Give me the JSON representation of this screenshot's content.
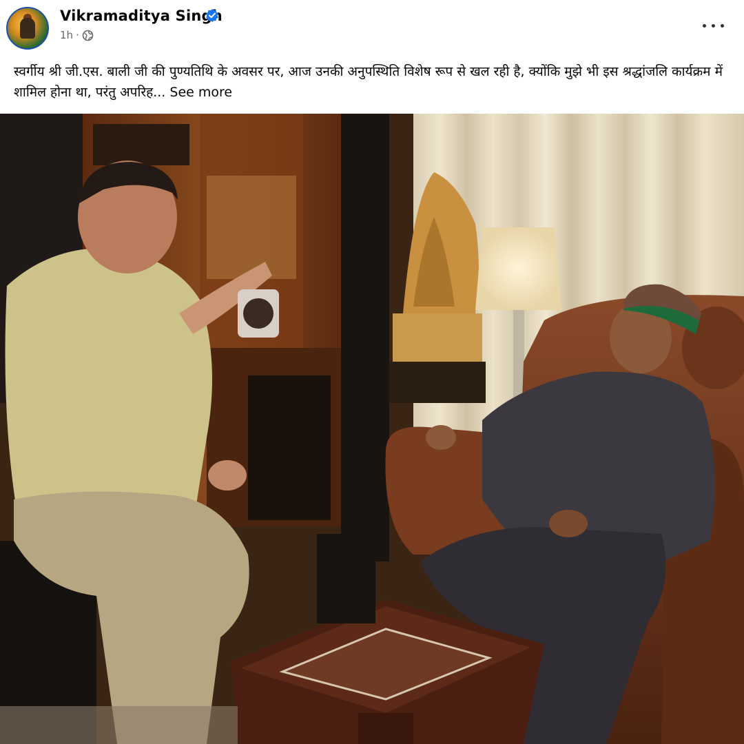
{
  "post": {
    "author": "Vikramaditya Singh",
    "time": "1h",
    "separator": "·",
    "text": "स्वर्गीय श्री जी.एस. बाली जी की पुण्यतिथि के अवसर पर, आज उनकी अनुपस्थिति विशेष रूप से खल रही है, क्योंकि मुझे भी इस श्रद्धांजलि कार्यक्रम में शामिल होना था, परंतु अपरिह...",
    "see_more": "See more"
  },
  "icons": {
    "verified": "verified-badge-icon",
    "audience": "globe-icon",
    "menu": "more-options-icon"
  },
  "colors": {
    "verified_blue": "#1877f2",
    "meta_gray": "#65676b",
    "avatar_ring": "#1d4fa8"
  }
}
